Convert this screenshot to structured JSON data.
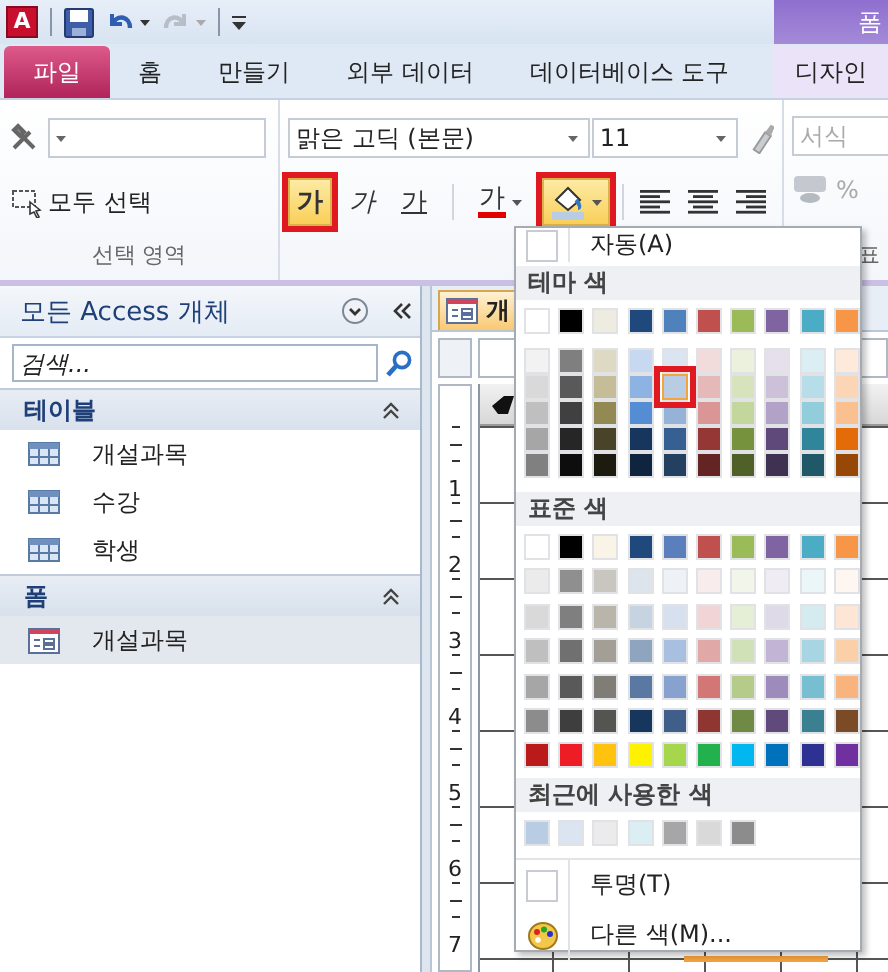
{
  "app_logo": "A",
  "context_tab_group": {
    "label": "폼"
  },
  "tabs": [
    {
      "label": "파일",
      "kind": "file"
    },
    {
      "label": "홈",
      "kind": "normal"
    },
    {
      "label": "만들기",
      "kind": "normal"
    },
    {
      "label": "외부 데이터",
      "kind": "normal"
    },
    {
      "label": "데이터베이스 도구",
      "kind": "normal"
    },
    {
      "label": "디자인",
      "kind": "context"
    }
  ],
  "selection_group": {
    "label": "선택 영역",
    "select_all": "모두 선택"
  },
  "font_group": {
    "font": "맑은 고딕 (본문)",
    "size": "11",
    "style_buttons": [
      {
        "label": "가",
        "kind": "bold",
        "on": true,
        "highlighted": true
      },
      {
        "label": "가",
        "kind": "italic",
        "on": false,
        "highlighted": false
      },
      {
        "label": "가",
        "kind": "underline",
        "on": false,
        "highlighted": false
      }
    ],
    "font_color": {
      "label": "가",
      "color": "#e00000"
    },
    "fill_button": {
      "on": true,
      "highlighted": true
    }
  },
  "format_group": {
    "format_placeholder": "서식",
    "percent": "%",
    "label": "표"
  },
  "nav_pane": {
    "title": "모든 Access 개체",
    "search_placeholder": "검색...",
    "groups": [
      {
        "label": "테이블",
        "items": [
          {
            "label": "개설과목",
            "kind": "table",
            "selected": false
          },
          {
            "label": "수강",
            "kind": "table",
            "selected": false
          },
          {
            "label": "학생",
            "kind": "table",
            "selected": false
          }
        ]
      },
      {
        "label": "폼",
        "items": [
          {
            "label": "개설과목",
            "kind": "form",
            "selected": true
          }
        ]
      }
    ]
  },
  "document_tab": {
    "label": "개"
  },
  "ruler_numbers": [
    "1",
    "2",
    "3",
    "4",
    "5",
    "6",
    "7"
  ],
  "color_menu": {
    "auto": "자동(A)",
    "theme": {
      "label": "테마 색",
      "base": [
        {
          "color": "#ffffff"
        },
        {
          "color": "#000000"
        },
        {
          "color": "#eeece1"
        },
        {
          "color": "#1f497d"
        },
        {
          "color": "#4f81bd"
        },
        {
          "color": "#c0504d"
        },
        {
          "color": "#9bbb59"
        },
        {
          "color": "#8064a2"
        },
        {
          "color": "#4bacc6"
        },
        {
          "color": "#f79646"
        }
      ],
      "shades": [
        [
          {
            "color": "#f2f2f2",
            "selected": false
          },
          {
            "color": "#d9d9d9",
            "selected": false
          },
          {
            "color": "#bfbfbf",
            "selected": false
          },
          {
            "color": "#a6a6a6",
            "selected": false
          },
          {
            "color": "#808080",
            "selected": false
          }
        ],
        [
          {
            "color": "#7f7f7f",
            "selected": false
          },
          {
            "color": "#595959",
            "selected": false
          },
          {
            "color": "#404040",
            "selected": false
          },
          {
            "color": "#262626",
            "selected": false
          },
          {
            "color": "#0d0d0d",
            "selected": false
          }
        ],
        [
          {
            "color": "#ddd9c3",
            "selected": false
          },
          {
            "color": "#c4bd97",
            "selected": false
          },
          {
            "color": "#938953",
            "selected": false
          },
          {
            "color": "#494429",
            "selected": false
          },
          {
            "color": "#1d1b10",
            "selected": false
          }
        ],
        [
          {
            "color": "#c6d9f0",
            "selected": false
          },
          {
            "color": "#8db3e2",
            "selected": false
          },
          {
            "color": "#548dd4",
            "selected": false
          },
          {
            "color": "#17365d",
            "selected": false
          },
          {
            "color": "#0f243e",
            "selected": false
          }
        ],
        [
          {
            "color": "#dbe5f1",
            "selected": false
          },
          {
            "color": "#b8cce4",
            "selected": true
          },
          {
            "color": "#95b3d7",
            "selected": false
          },
          {
            "color": "#366092",
            "selected": false
          },
          {
            "color": "#244061",
            "selected": false
          }
        ],
        [
          {
            "color": "#f2dcdb",
            "selected": false
          },
          {
            "color": "#e5b9b7",
            "selected": false
          },
          {
            "color": "#d99694",
            "selected": false
          },
          {
            "color": "#953734",
            "selected": false
          },
          {
            "color": "#632423",
            "selected": false
          }
        ],
        [
          {
            "color": "#ebf1dd",
            "selected": false
          },
          {
            "color": "#d7e3bc",
            "selected": false
          },
          {
            "color": "#c3d69b",
            "selected": false
          },
          {
            "color": "#76923c",
            "selected": false
          },
          {
            "color": "#4f6128",
            "selected": false
          }
        ],
        [
          {
            "color": "#e5e0ec",
            "selected": false
          },
          {
            "color": "#ccc1d9",
            "selected": false
          },
          {
            "color": "#b2a2c7",
            "selected": false
          },
          {
            "color": "#5f497a",
            "selected": false
          },
          {
            "color": "#3f3151",
            "selected": false
          }
        ],
        [
          {
            "color": "#dbeef3",
            "selected": false
          },
          {
            "color": "#b7dde8",
            "selected": false
          },
          {
            "color": "#92cddc",
            "selected": false
          },
          {
            "color": "#31859b",
            "selected": false
          },
          {
            "color": "#205867",
            "selected": false
          }
        ],
        [
          {
            "color": "#fdeada",
            "selected": false
          },
          {
            "color": "#fbd5b5",
            "selected": false
          },
          {
            "color": "#fac08f",
            "selected": false
          },
          {
            "color": "#e36c09",
            "selected": false
          },
          {
            "color": "#974806",
            "selected": false
          }
        ]
      ]
    },
    "standard": {
      "label": "표준 색",
      "rows": [
        [
          {
            "color": "#ffffff"
          },
          {
            "color": "#000000"
          },
          {
            "color": "#f9f3e8"
          },
          {
            "color": "#1f497d"
          },
          {
            "color": "#5b7fbd"
          },
          {
            "color": "#c0504d"
          },
          {
            "color": "#9bbb59"
          },
          {
            "color": "#8064a2"
          },
          {
            "color": "#4bacc6"
          },
          {
            "color": "#f79646"
          }
        ],
        [
          {
            "color": "#ebebeb"
          },
          {
            "color": "#8f8f8f"
          },
          {
            "color": "#c8c6be"
          },
          {
            "color": "#dde4ec"
          },
          {
            "color": "#eef2f7"
          },
          {
            "color": "#f8ecec"
          },
          {
            "color": "#f2f6ea"
          },
          {
            "color": "#efedf3"
          },
          {
            "color": "#ebf6f8"
          },
          {
            "color": "#fdf6f1"
          }
        ],
        [
          {
            "color": "#d9d9d9"
          },
          {
            "color": "#7f7f7f"
          },
          {
            "color": "#bab5aa"
          },
          {
            "color": "#c6d3e0"
          },
          {
            "color": "#d6e0ee"
          },
          {
            "color": "#f1d4d5"
          },
          {
            "color": "#e5efd6"
          },
          {
            "color": "#dedae8"
          },
          {
            "color": "#d4ebf0"
          },
          {
            "color": "#fde6d6"
          }
        ],
        [
          {
            "color": "#bfbfbf"
          },
          {
            "color": "#707070"
          },
          {
            "color": "#a39e96"
          },
          {
            "color": "#8ea4bf"
          },
          {
            "color": "#a9bfe0"
          },
          {
            "color": "#e0a8a7"
          },
          {
            "color": "#d0e1b8"
          },
          {
            "color": "#c1b4d4"
          },
          {
            "color": "#a7d6e2"
          },
          {
            "color": "#fbcfa8"
          }
        ],
        [
          {
            "color": "#a6a6a6"
          },
          {
            "color": "#595959"
          },
          {
            "color": "#7f7d76"
          },
          {
            "color": "#5a78a1"
          },
          {
            "color": "#87a2cf"
          },
          {
            "color": "#d27676"
          },
          {
            "color": "#b5cb89"
          },
          {
            "color": "#9d8bbb"
          },
          {
            "color": "#78bed1"
          },
          {
            "color": "#f9b47e"
          }
        ],
        [
          {
            "color": "#8c8c8c"
          },
          {
            "color": "#3e3e3e"
          },
          {
            "color": "#545450"
          },
          {
            "color": "#17365d"
          },
          {
            "color": "#3f5f8a"
          },
          {
            "color": "#8f3633"
          },
          {
            "color": "#6f8a45"
          },
          {
            "color": "#5f4a7b"
          },
          {
            "color": "#3a8090"
          },
          {
            "color": "#7b4a26"
          }
        ],
        [
          {
            "color": "#bb1a1a"
          },
          {
            "color": "#ee1c24"
          },
          {
            "color": "#ffc20e"
          },
          {
            "color": "#fff200"
          },
          {
            "color": "#a5d64b"
          },
          {
            "color": "#22b14c"
          },
          {
            "color": "#00b7ef"
          },
          {
            "color": "#0072bc"
          },
          {
            "color": "#2e3192"
          },
          {
            "color": "#7030a0"
          }
        ]
      ]
    },
    "recent": {
      "label": "최근에 사용한 색",
      "colors": [
        {
          "color": "#b8cce4"
        },
        {
          "color": "#dbe5f1"
        },
        {
          "color": "#ebebeb"
        },
        {
          "color": "#dbeef3"
        },
        {
          "color": "#a6a6a6"
        },
        {
          "color": "#d9d9d9"
        },
        {
          "color": "#8c8c8c"
        }
      ]
    },
    "transparent": "투명(T)",
    "more_colors": "다른 색(M)..."
  }
}
